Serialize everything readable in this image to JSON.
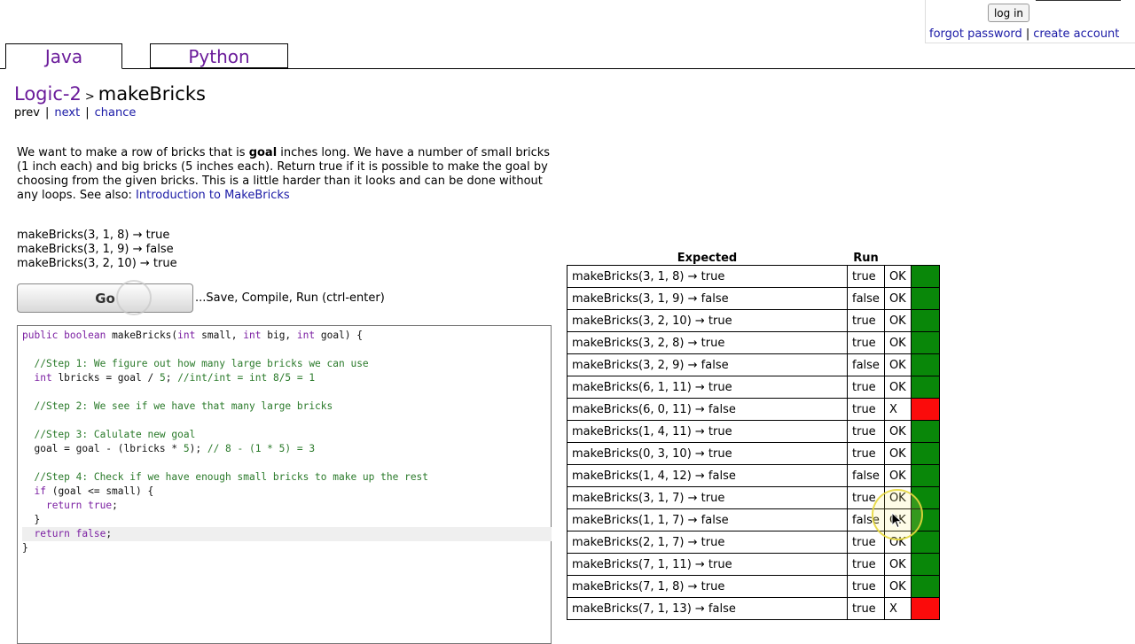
{
  "account": {
    "login_label": "log in",
    "forgot_password": "forgot password",
    "separator": "|",
    "create_account": "create account"
  },
  "tabs": [
    {
      "label": "Java",
      "active": true
    },
    {
      "label": "Python",
      "active": false
    }
  ],
  "breadcrumb": {
    "parent": "Logic-2",
    "arrow": ">",
    "current": "makeBricks"
  },
  "nav": {
    "prev": "prev",
    "next": "next",
    "chance": "chance",
    "separator": "|"
  },
  "description": {
    "part1": "We want to make a row of bricks that is ",
    "bold": "goal",
    "part2": " inches long. We have a number of small bricks (1 inch each) and big bricks (5 inches each). Return true if it is possible to make the goal by choosing from the given bricks. This is a little harder than it looks and can be done without any loops. See also: ",
    "link": "Introduction to MakeBricks"
  },
  "examples": [
    "makeBricks(3, 1, 8) → true",
    "makeBricks(3, 1, 9) → false",
    "makeBricks(3, 2, 10) → true"
  ],
  "go": {
    "label": "Go",
    "hint": "...Save, Compile, Run (ctrl-enter)"
  },
  "code_lines": [
    "public boolean makeBricks(int small, int big, int goal) {",
    "",
    "  //Step 1: We figure out how many large bricks we can use",
    "  int lbricks = goal / 5; //int/int = int 8/5 = 1",
    "",
    "  //Step 2: We see if we have that many large bricks",
    "",
    "  //Step 3: Calulate new goal",
    "  goal = goal - (lbricks * 5); // 8 - (1 * 5) = 3",
    "",
    "  //Step 4: Check if we have enough small bricks to make up the rest",
    "  if (goal <= small) {",
    "    return true;",
    "  }",
    "  return false;",
    "}"
  ],
  "results": {
    "header_expected": "Expected",
    "header_run": "Run",
    "rows": [
      {
        "expected": "makeBricks(3, 1, 8) → true",
        "run": "true",
        "ok": "OK",
        "pass": true
      },
      {
        "expected": "makeBricks(3, 1, 9) → false",
        "run": "false",
        "ok": "OK",
        "pass": true
      },
      {
        "expected": "makeBricks(3, 2, 10) → true",
        "run": "true",
        "ok": "OK",
        "pass": true
      },
      {
        "expected": "makeBricks(3, 2, 8) → true",
        "run": "true",
        "ok": "OK",
        "pass": true
      },
      {
        "expected": "makeBricks(3, 2, 9) → false",
        "run": "false",
        "ok": "OK",
        "pass": true
      },
      {
        "expected": "makeBricks(6, 1, 11) → true",
        "run": "true",
        "ok": "OK",
        "pass": true
      },
      {
        "expected": "makeBricks(6, 0, 11) → false",
        "run": "true",
        "ok": "X",
        "pass": false
      },
      {
        "expected": "makeBricks(1, 4, 11) → true",
        "run": "true",
        "ok": "OK",
        "pass": true
      },
      {
        "expected": "makeBricks(0, 3, 10) → true",
        "run": "true",
        "ok": "OK",
        "pass": true
      },
      {
        "expected": "makeBricks(1, 4, 12) → false",
        "run": "false",
        "ok": "OK",
        "pass": true
      },
      {
        "expected": "makeBricks(3, 1, 7) → true",
        "run": "true",
        "ok": "OK",
        "pass": true
      },
      {
        "expected": "makeBricks(1, 1, 7) → false",
        "run": "false",
        "ok": "OK",
        "pass": true
      },
      {
        "expected": "makeBricks(2, 1, 7) → true",
        "run": "true",
        "ok": "OK",
        "pass": true
      },
      {
        "expected": "makeBricks(7, 1, 11) → true",
        "run": "true",
        "ok": "OK",
        "pass": true
      },
      {
        "expected": "makeBricks(7, 1, 8) → true",
        "run": "true",
        "ok": "OK",
        "pass": true
      },
      {
        "expected": "makeBricks(7, 1, 13) → false",
        "run": "true",
        "ok": "X",
        "pass": false
      }
    ]
  },
  "colors": {
    "pass": "#098709",
    "fail": "#fb0b0b",
    "tab_text": "#6a1b9a",
    "link": "#1a1aa6"
  }
}
